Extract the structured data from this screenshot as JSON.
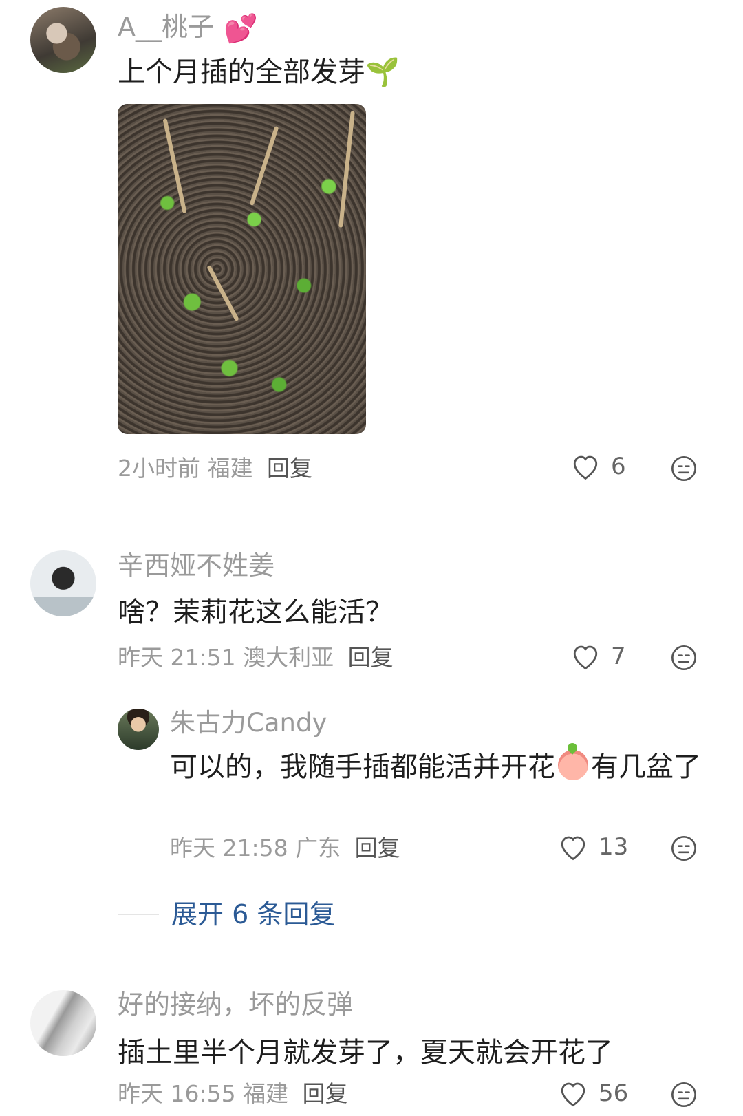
{
  "comments": [
    {
      "username": "A__桃子",
      "badge_icon": "💕",
      "content": "上个月插的全部发芽",
      "content_emoji": "🌱",
      "has_image": true,
      "time": "2小时前",
      "location": "福建",
      "reply_label": "回复",
      "likes": "6"
    },
    {
      "username": "辛西娅不姓姜",
      "content": "啥？茉莉花这么能活？",
      "time": "昨天 21:51",
      "location": "澳大利亚",
      "reply_label": "回复",
      "likes": "7",
      "reply": {
        "username": "朱古力Candy",
        "content_part1": "可以的，我随手插都能活并开花",
        "content_part2": "有几盆了",
        "time": "昨天 21:58",
        "location": "广东",
        "reply_label": "回复",
        "likes": "13"
      },
      "expand_label": "展开 6 条回复"
    },
    {
      "username": "好的接纳，坏的反弹",
      "content": "插土里半个月就发芽了，夏天就会开花了",
      "time": "昨天 16:55",
      "location": "福建",
      "reply_label": "回复",
      "likes": "56"
    }
  ]
}
